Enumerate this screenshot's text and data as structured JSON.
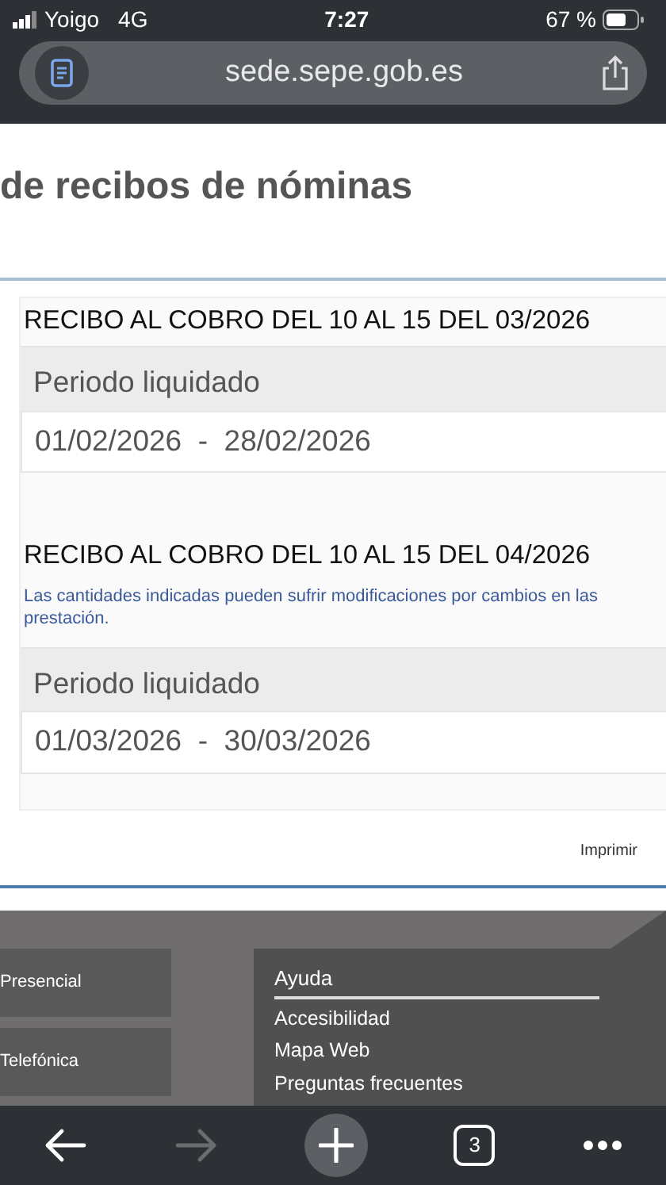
{
  "status_bar": {
    "carrier": "Yoigo",
    "network": "4G",
    "time": "7:27",
    "battery": "67 %"
  },
  "address_bar": {
    "url": "sede.sepe.gob.es"
  },
  "page": {
    "title": "de recibos de nóminas",
    "receipts": [
      {
        "title": "RECIBO AL COBRO DEL 10 AL 15 DEL 03/2026",
        "period_label": "Periodo liquidado",
        "period": "01/02/2026  -  28/02/2026"
      },
      {
        "title": "RECIBO AL COBRO DEL 10 AL 15 DEL 04/2026",
        "note": "Las cantidades indicadas pueden sufrir modificaciones por cambios en las\nprestación.",
        "period_label": "Periodo liquidado",
        "period": "01/03/2026  -  30/03/2026"
      }
    ],
    "print_link": "Imprimir"
  },
  "footer": {
    "channels": [
      "Presencial",
      "Telefónica"
    ],
    "help_title": "Ayuda",
    "help_links": [
      "Accesibilidad",
      "Mapa Web",
      "Preguntas frecuentes"
    ]
  },
  "toolbar": {
    "back_disabled": false,
    "forward_disabled": true,
    "tab_count": "3"
  }
}
